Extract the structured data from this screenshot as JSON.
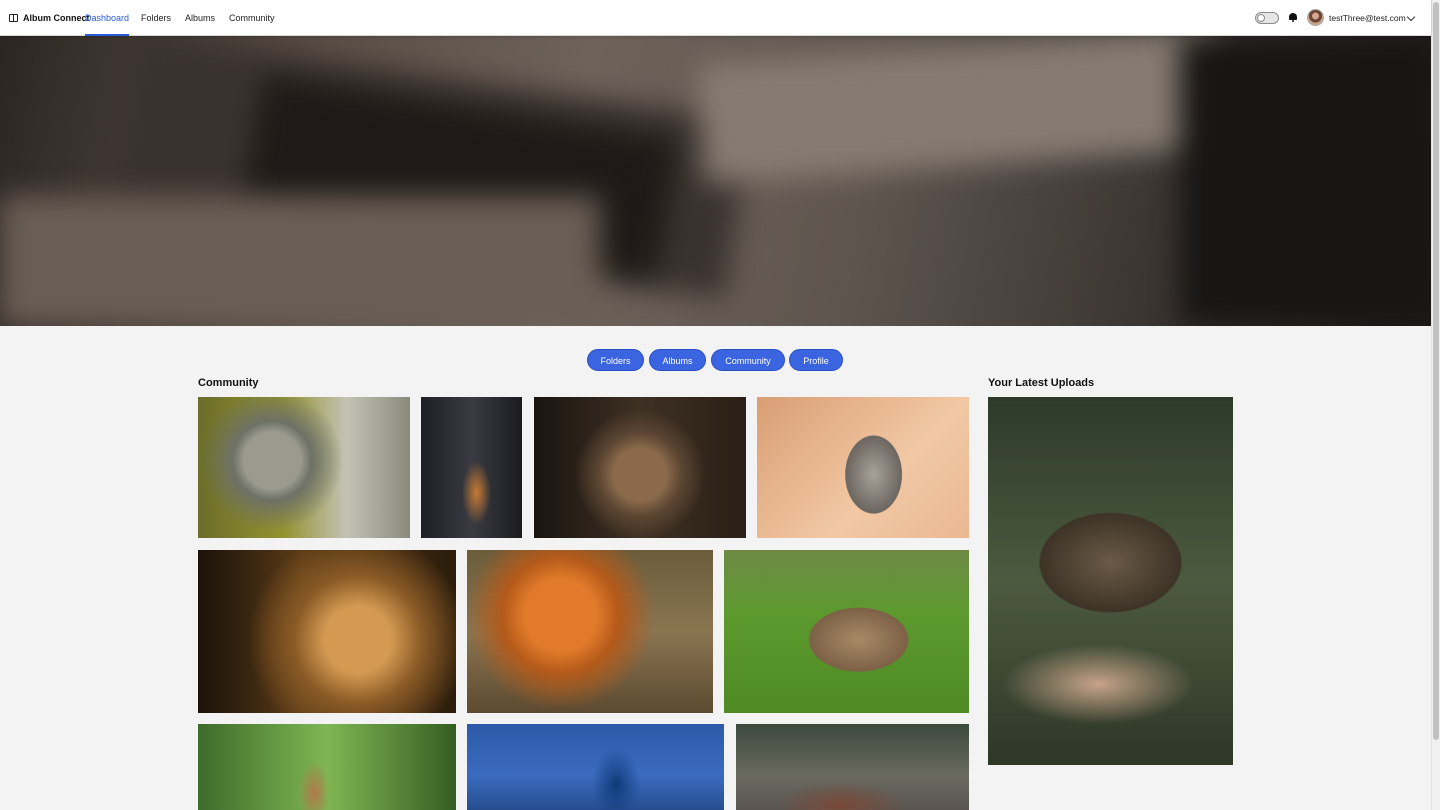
{
  "app": {
    "name": "Album Connect",
    "logo_icon": "book-open-icon"
  },
  "nav": {
    "items": [
      {
        "label": "Dashboard",
        "active": true
      },
      {
        "label": "Folders",
        "active": false
      },
      {
        "label": "Albums",
        "active": false
      },
      {
        "label": "Community",
        "active": false
      }
    ]
  },
  "user": {
    "email": "testThree@test.com",
    "theme_toggle_on": false
  },
  "quick_links": [
    "Folders",
    "Albums",
    "Community",
    "Profile"
  ],
  "community": {
    "title": "Community",
    "photos": [
      "monkey",
      "cat-by-chair",
      "wolf",
      "scottish-fold-cat",
      "lion",
      "red-fox",
      "brown-bear",
      "fawn-deer",
      "peacock",
      "bison"
    ]
  },
  "latest_uploads": {
    "title": "Your Latest Uploads",
    "photos": [
      "tortoise-in-hands"
    ]
  },
  "colors": {
    "accent": "#3b64e0",
    "active_nav": "#2a5bd7",
    "background": "#f3f3f3"
  }
}
